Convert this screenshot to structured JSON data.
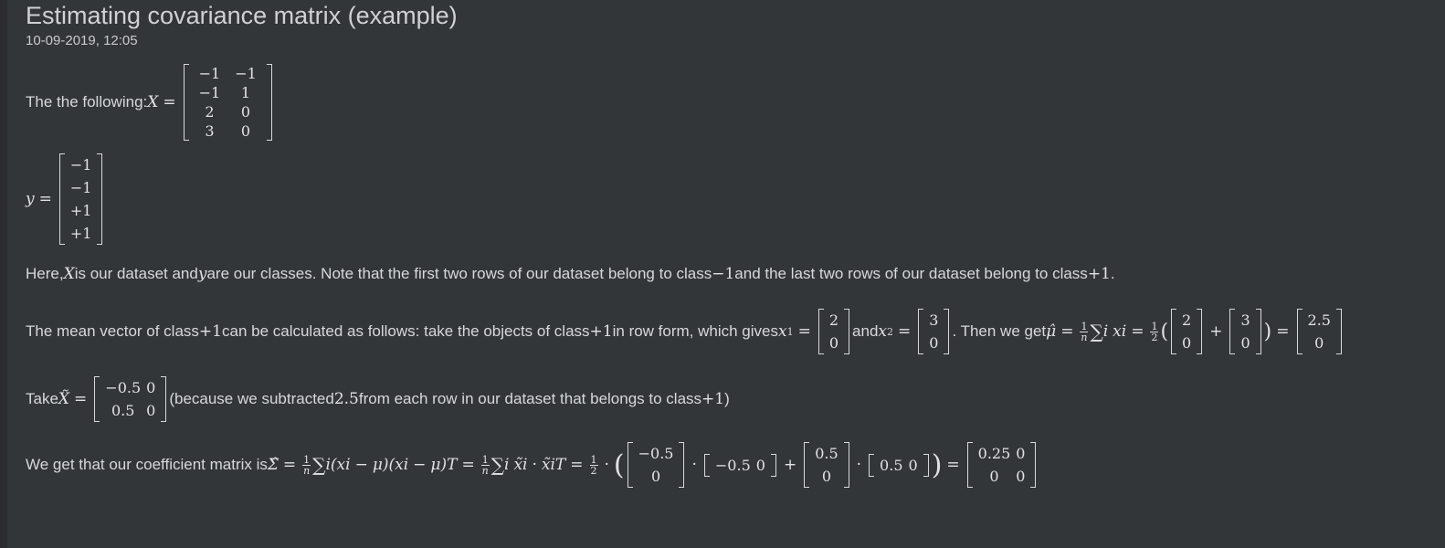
{
  "header": {
    "title": "Estimating covariance matrix (example)",
    "date": "10-09-2019, 12:05"
  },
  "line1": {
    "text": "The the following: ",
    "var": "X",
    "eq": "=",
    "matrix": [
      "−1",
      "−1",
      "−1",
      "1",
      "2",
      "0",
      "3",
      "0"
    ]
  },
  "line2": {
    "var": "y",
    "eq": "=",
    "matrix": [
      "−1",
      "−1",
      "+1",
      "+1"
    ]
  },
  "line3": {
    "t1": "Here, ",
    "X": "X",
    "t2": " is our dataset and ",
    "y": "y",
    "t3": " are our classes. Note that the first two rows of our dataset belong to class ",
    "c1": "−1",
    "t4": " and the last two rows of our dataset belong to class ",
    "c2": "+1",
    "t5": "."
  },
  "line4": {
    "t1": "The mean vector of class ",
    "c": "+1",
    "t2": " can be calculated as follows: take the objects of class ",
    "c2": "+1",
    "t3": " in row form, which gives ",
    "x": "x",
    "s1": "1",
    "eq": "=",
    "v1": [
      "2",
      "0"
    ],
    "t4": " and ",
    "s2": "2",
    "v2": [
      "3",
      "0"
    ],
    "t5": ". Then we get ",
    "mu": "μ̂",
    "one": "1",
    "n": "n",
    "sum": "∑",
    "i": "i",
    "two": "2",
    "plus": "+",
    "lp": "(",
    "rp": ")",
    "result": [
      "2.5",
      "0"
    ]
  },
  "line5": {
    "t1": "Take ",
    "xt": "X̃",
    "eq": "=",
    "matrix": [
      "−0.5",
      "0",
      "0.5",
      "0"
    ],
    "t2": " (because we subtracted ",
    "val": "2.5",
    "t3": " from each row in our dataset that belongs to class ",
    "c": "+1",
    "t4": ")"
  },
  "line6": {
    "t1": "We get that our coefficient matrix is ",
    "sigma": "Σ̂",
    "eq": "=",
    "one": "1",
    "n": "n",
    "sum": "∑",
    "i": "i",
    "term1": "(x",
    "minus": "−",
    "mu": "μ",
    "close1": ")(x",
    "close2": ")",
    "T": "T",
    "xt": "x̃",
    "dot": "·",
    "two": "2",
    "lp": "(",
    "rp": ")",
    "plus": "+",
    "colv1": [
      "−0.5",
      "0"
    ],
    "rowv1": [
      "−0.5",
      "0"
    ],
    "colv2": [
      "0.5",
      "0"
    ],
    "rowv2": [
      "0.5",
      "0"
    ],
    "result": [
      "0.25",
      "0",
      "0",
      "0"
    ]
  }
}
